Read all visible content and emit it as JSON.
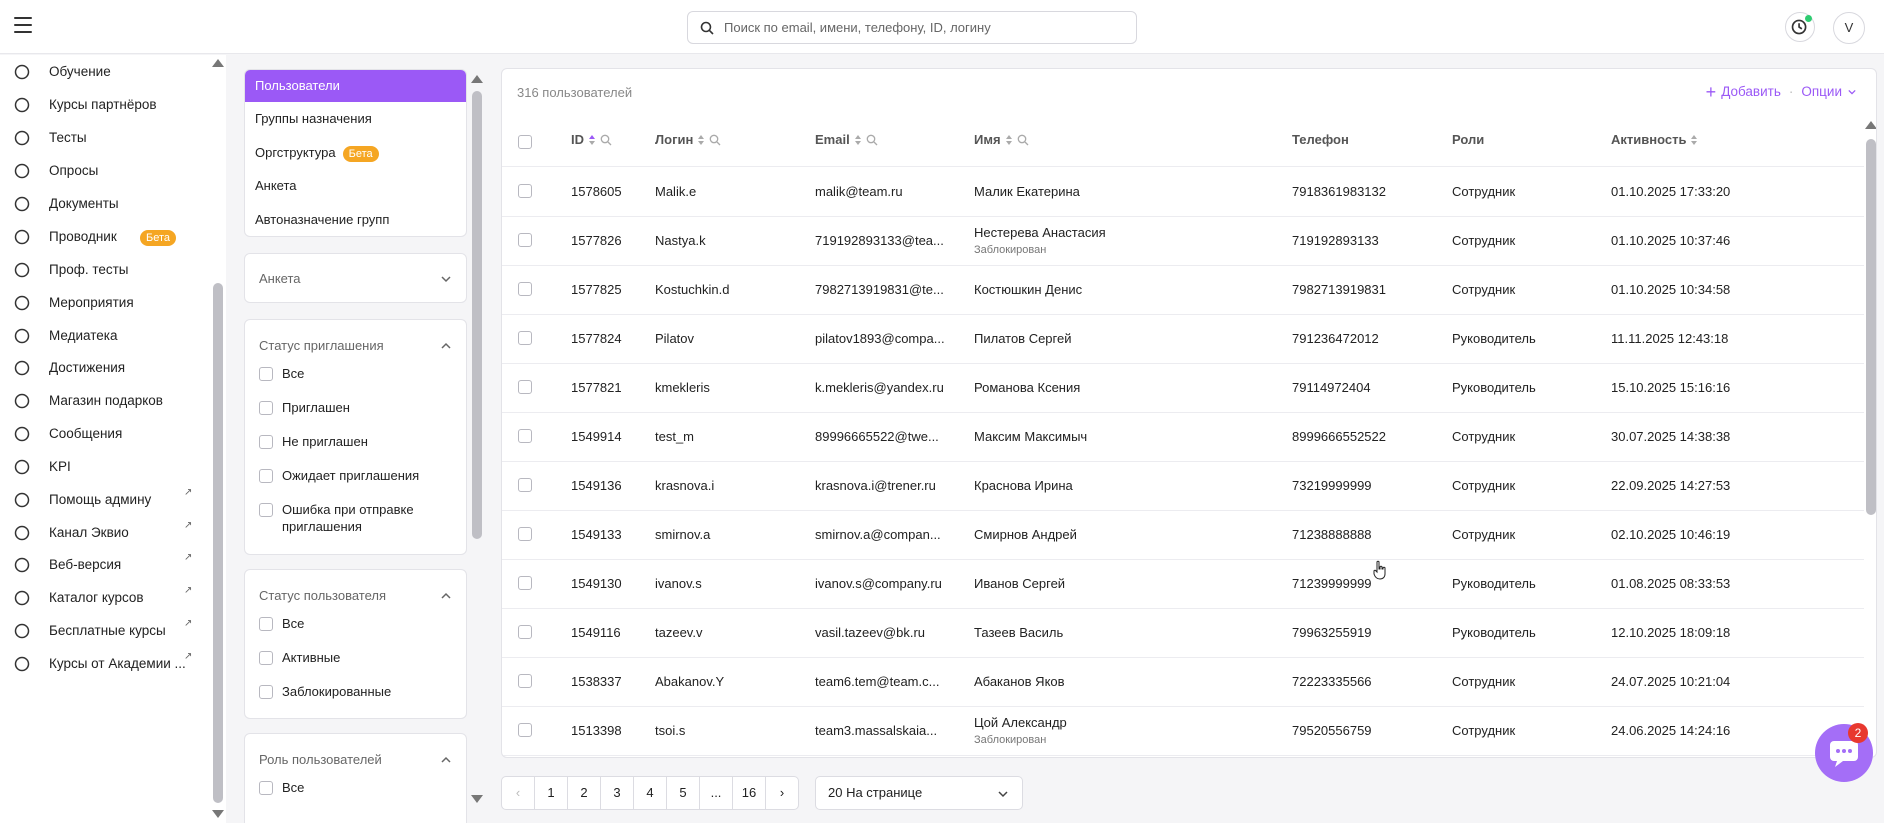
{
  "header": {
    "search_placeholder": "Поиск по email, имени, телефону, ID, логину",
    "avatar_letter": "V"
  },
  "sidebar": {
    "items": [
      {
        "label": "Обучение",
        "icon": "learning-icon",
        "badge": "",
        "external": false
      },
      {
        "label": "Курсы партнёров",
        "icon": "partner-courses-icon",
        "badge": "",
        "external": false
      },
      {
        "label": "Тесты",
        "icon": "tests-icon",
        "badge": "",
        "external": false
      },
      {
        "label": "Опросы",
        "icon": "surveys-icon",
        "badge": "",
        "external": false
      },
      {
        "label": "Документы",
        "icon": "documents-icon",
        "badge": "",
        "external": false
      },
      {
        "label": "Проводник",
        "icon": "folder-icon",
        "badge": "Бета",
        "external": false
      },
      {
        "label": "Проф. тесты",
        "icon": "prof-tests-icon",
        "badge": "",
        "external": false
      },
      {
        "label": "Мероприятия",
        "icon": "calendar-icon",
        "badge": "",
        "external": false
      },
      {
        "label": "Медиатека",
        "icon": "media-icon",
        "badge": "",
        "external": false
      },
      {
        "label": "Достижения",
        "icon": "trophy-icon",
        "badge": "",
        "external": false
      },
      {
        "label": "Магазин подарков",
        "icon": "gift-icon",
        "badge": "",
        "external": false
      },
      {
        "label": "Сообщения",
        "icon": "messages-icon",
        "badge": "",
        "external": false
      },
      {
        "label": "KPI",
        "icon": "kpi-icon",
        "badge": "",
        "external": false
      },
      {
        "label": "Помощь админу",
        "icon": "star-icon",
        "badge": "",
        "external": true
      },
      {
        "label": "Канал Эквио",
        "icon": "send-icon",
        "badge": "",
        "external": true
      },
      {
        "label": "Веб-версия",
        "icon": "monitor-icon",
        "badge": "",
        "external": true
      },
      {
        "label": "Каталог курсов",
        "icon": "external-link-icon",
        "badge": "",
        "external": true
      },
      {
        "label": "Бесплатные курсы",
        "icon": "external-link-icon",
        "badge": "",
        "external": true
      },
      {
        "label": "Курсы от Академии ...",
        "icon": "external-link-icon",
        "badge": "",
        "external": true
      }
    ]
  },
  "filters": {
    "nav": [
      {
        "label": "Пользователи",
        "badge": "",
        "active": true
      },
      {
        "label": "Группы назначения",
        "badge": "",
        "active": false
      },
      {
        "label": "Оргструктура",
        "badge": "Бета",
        "active": false
      },
      {
        "label": "Анкета",
        "badge": "",
        "active": false
      },
      {
        "label": "Автоназначение групп",
        "badge": "",
        "active": false
      }
    ],
    "anketa_title": "Анкета",
    "invite_status": {
      "title": "Статус приглашения",
      "options": [
        "Все",
        "Приглашен",
        "Не приглашен",
        "Ожидает приглашения",
        "Ошибка при отправке приглашения"
      ]
    },
    "user_status": {
      "title": "Статус пользователя",
      "options": [
        "Все",
        "Активные",
        "Заблокированные"
      ]
    },
    "user_role": {
      "title": "Роль пользователей",
      "options": [
        "Все"
      ]
    }
  },
  "table": {
    "count_label": "316 пользователей",
    "add_label": "Добавить",
    "options_label": "Опции",
    "columns": [
      "ID",
      "Логин",
      "Email",
      "Имя",
      "Телефон",
      "Роли",
      "Активность"
    ],
    "rows": [
      {
        "id": "1578605",
        "login": "Malik.e",
        "email": "malik@team.ru",
        "name": "Малик Екатерина",
        "sub": "",
        "phone": "7918361983132",
        "role": "Сотрудник",
        "activity": "01.10.2025 17:33:20"
      },
      {
        "id": "1577826",
        "login": "Nastya.k",
        "email": "719192893133@tea...",
        "name": "Нестерева Анастасия",
        "sub": "Заблокирован",
        "phone": "719192893133",
        "role": "Сотрудник",
        "activity": "01.10.2025 10:37:46"
      },
      {
        "id": "1577825",
        "login": "Kostuchkin.d",
        "email": "7982713919831@te...",
        "name": "Костюшкин Денис",
        "sub": "",
        "phone": "7982713919831",
        "role": "Сотрудник",
        "activity": "01.10.2025 10:34:58"
      },
      {
        "id": "1577824",
        "login": "Pilatov",
        "email": "pilatov1893@compa...",
        "name": "Пилатов Сергей",
        "sub": "",
        "phone": "791236472012",
        "role": "Руководитель",
        "activity": "11.11.2025 12:43:18"
      },
      {
        "id": "1577821",
        "login": "kmekleris",
        "email": "k.mekleris@yandex.ru",
        "name": "Романова Ксения",
        "sub": "",
        "phone": "79114972404",
        "role": "Руководитель",
        "activity": "15.10.2025 15:16:16"
      },
      {
        "id": "1549914",
        "login": "test_m",
        "email": "89996665522@twe...",
        "name": "Максим Максимыч",
        "sub": "",
        "phone": "8999666552522",
        "role": "Сотрудник",
        "activity": "30.07.2025 14:38:38"
      },
      {
        "id": "1549136",
        "login": "krasnova.i",
        "email": "krasnova.i@trener.ru",
        "name": "Краснова Ирина",
        "sub": "",
        "phone": "73219999999",
        "role": "Сотрудник",
        "activity": "22.09.2025 14:27:53"
      },
      {
        "id": "1549133",
        "login": "smirnov.a",
        "email": "smirnov.a@compan...",
        "name": "Смирнов Андрей",
        "sub": "",
        "phone": "71238888888",
        "role": "Сотрудник",
        "activity": "02.10.2025 10:46:19"
      },
      {
        "id": "1549130",
        "login": "ivanov.s",
        "email": "ivanov.s@company.ru",
        "name": "Иванов Сергей",
        "sub": "",
        "phone": "71239999999",
        "role": "Руководитель",
        "activity": "01.08.2025 08:33:53"
      },
      {
        "id": "1549116",
        "login": "tazeev.v",
        "email": "vasil.tazeev@bk.ru",
        "name": "Тазеев Василь",
        "sub": "",
        "phone": "79963255919",
        "role": "Руководитель",
        "activity": "12.10.2025 18:09:18"
      },
      {
        "id": "1538337",
        "login": "Abakanov.Y",
        "email": "team6.tem@team.c...",
        "name": "Абаканов Яков",
        "sub": "",
        "phone": "72223335566",
        "role": "Сотрудник",
        "activity": "24.07.2025 10:21:04"
      },
      {
        "id": "1513398",
        "login": "tsoi.s",
        "email": "team3.massalskaia...",
        "name": "Цой Александр",
        "sub": "Заблокирован",
        "phone": "79520556759",
        "role": "Сотрудник",
        "activity": "24.06.2025 14:24:16"
      }
    ]
  },
  "pagination": {
    "pages": [
      "1",
      "2",
      "3",
      "4",
      "5",
      "...",
      "16"
    ],
    "per_page": "20 На странице"
  },
  "chat": {
    "badge": "2"
  },
  "colors": {
    "accent": "#9b59f6",
    "badge": "#f5a623",
    "chat": "#a46ef7",
    "chat_badge": "#e8382f"
  }
}
